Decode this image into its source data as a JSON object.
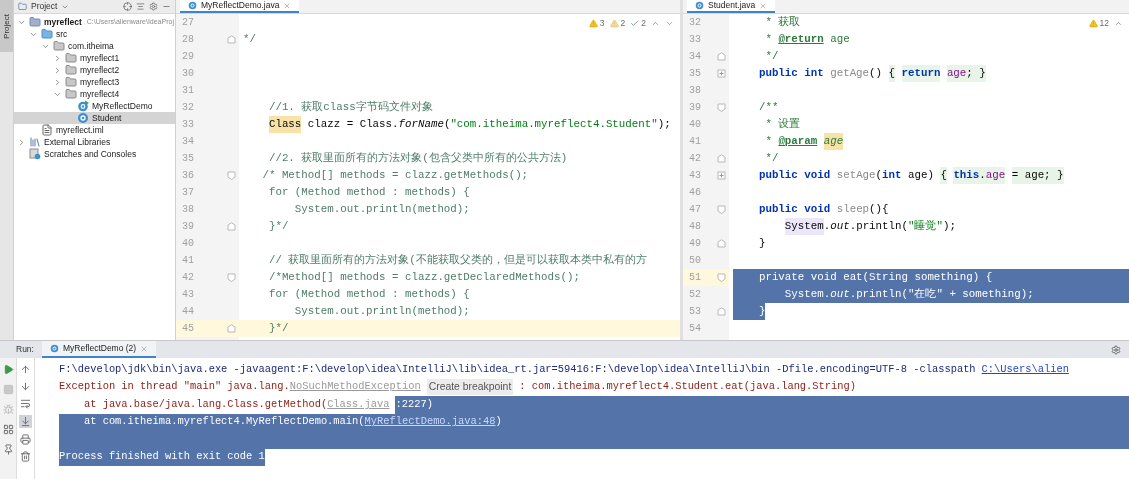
{
  "tool_strip": {
    "label": "Project",
    "selected": true
  },
  "project": {
    "title": "Project",
    "tree": [
      {
        "label": "myreflect",
        "path": "C:\\Users\\alienware\\IdeaProj",
        "kind": "module",
        "expanded": true,
        "selected": false,
        "children": [
          {
            "label": "src",
            "kind": "source",
            "expanded": true,
            "selected": false,
            "children": [
              {
                "label": "com.itheima",
                "kind": "package",
                "expanded": true,
                "selected": false,
                "children": [
                  {
                    "label": "myreflect1",
                    "kind": "package",
                    "expanded": false,
                    "selected": false
                  },
                  {
                    "label": "myreflect2",
                    "kind": "package",
                    "expanded": false,
                    "selected": false
                  },
                  {
                    "label": "myreflect3",
                    "kind": "package",
                    "expanded": false,
                    "selected": false
                  },
                  {
                    "label": "myreflect4",
                    "kind": "package",
                    "expanded": true,
                    "selected": false,
                    "children": [
                      {
                        "label": "MyReflectDemo",
                        "kind": "main-class",
                        "selected": false
                      },
                      {
                        "label": "Student",
                        "kind": "class",
                        "selected": true
                      }
                    ]
                  }
                ]
              }
            ]
          },
          {
            "label": "myreflect.iml",
            "kind": "iml",
            "selected": false
          }
        ]
      },
      {
        "label": "External Libraries",
        "kind": "libraries",
        "expanded": false,
        "selected": false
      },
      {
        "label": "Scratches and Consoles",
        "kind": "scratches",
        "selected": false
      }
    ]
  },
  "editors": [
    {
      "tab": "MyReflectDemo.java",
      "inspections": [
        {
          "kind": "warning",
          "count": "3"
        },
        {
          "kind": "weak-warning",
          "count": "2"
        },
        {
          "kind": "typo",
          "count": "2"
        }
      ],
      "lines": [
        {
          "number": "27"
        },
        {
          "number": "28",
          "fold_end": true,
          "segments": [
            {
              "text": "*/",
              "kind": "comment"
            }
          ]
        },
        {
          "number": "29"
        },
        {
          "number": "30"
        },
        {
          "number": "31"
        },
        {
          "number": "32",
          "segments": [
            {
              "text": "    //1. 获取class字节码文件对象",
              "kind": "comment"
            }
          ]
        },
        {
          "number": "33",
          "segments": [
            {
              "text": "    Class",
              "kind": "highlight"
            },
            {
              "text": " clazz = Class.",
              "kind": "plain"
            },
            {
              "text": "forName",
              "kind": "static"
            },
            {
              "text": "(",
              "kind": "plain"
            },
            {
              "text": "\"com.itheima.myreflect4.Student\"",
              "kind": "string"
            },
            {
              "text": ");",
              "kind": "plain"
            }
          ]
        },
        {
          "number": "34"
        },
        {
          "number": "35",
          "segments": [
            {
              "text": "    //2. 获取里面所有的方法对象(包含父类中所有的公共方法)",
              "kind": "comment"
            }
          ]
        },
        {
          "number": "36",
          "fold_start": true,
          "segments": [
            {
              "text": "   /* Method[] methods = clazz.getMethods();",
              "kind": "comment"
            }
          ]
        },
        {
          "number": "37",
          "segments": [
            {
              "text": "    for (Method method : methods) {",
              "kind": "comment"
            }
          ]
        },
        {
          "number": "38",
          "segments": [
            {
              "text": "        System.out.println(method);",
              "kind": "comment"
            }
          ]
        },
        {
          "number": "39",
          "fold_end": true,
          "segments": [
            {
              "text": "    }*/",
              "kind": "comment"
            }
          ]
        },
        {
          "number": "40"
        },
        {
          "number": "41",
          "segments": [
            {
              "text": "    // 获取里面所有的方法对象(不能获取父类的，但是可以获取本类中私有的方",
              "kind": "comment"
            }
          ]
        },
        {
          "number": "42",
          "fold_start": true,
          "segments": [
            {
              "text": "    /*Method[] methods = clazz.getDeclaredMethods();",
              "kind": "comment"
            }
          ]
        },
        {
          "number": "43",
          "segments": [
            {
              "text": "    for (Method method : methods) {",
              "kind": "comment"
            }
          ]
        },
        {
          "number": "44",
          "segments": [
            {
              "text": "        System.out.println(method);",
              "kind": "comment"
            }
          ]
        },
        {
          "number": "45",
          "fold_end": true,
          "current": true,
          "segments": [
            {
              "text": "    }*/",
              "kind": "comment"
            }
          ]
        }
      ]
    },
    {
      "tab": "Student.java",
      "inspections": [
        {
          "kind": "warning",
          "count": "12"
        }
      ],
      "lines": [
        {
          "number": "32",
          "segments": [
            {
              "text": "     * 获取",
              "kind": "doc"
            }
          ]
        },
        {
          "number": "33",
          "segments": [
            {
              "text": "     * ",
              "kind": "doc"
            },
            {
              "text": "@return",
              "kind": "doc-tag"
            },
            {
              "text": " age",
              "kind": "doc"
            }
          ]
        },
        {
          "number": "34",
          "fold_end": true,
          "segments": [
            {
              "text": "     */",
              "kind": "doc"
            }
          ]
        },
        {
          "number": "35",
          "collapsed": true,
          "segments": [
            {
              "text": "    public int ",
              "kind": "keyword"
            },
            {
              "text": "getAge",
              "kind": "unused"
            },
            {
              "text": "() ",
              "kind": "plain"
            },
            {
              "text": "{ ",
              "kind": "folded"
            },
            {
              "text": "return ",
              "kind": "keyword-folded"
            },
            {
              "text": "age",
              "kind": "field-folded"
            },
            {
              "text": "; }",
              "kind": "folded"
            }
          ]
        },
        {
          "number": "38"
        },
        {
          "number": "39",
          "fold_start": true,
          "segments": [
            {
              "text": "    /**",
              "kind": "doc"
            }
          ]
        },
        {
          "number": "40",
          "segments": [
            {
              "text": "     * 设置",
              "kind": "doc"
            }
          ]
        },
        {
          "number": "41",
          "segments": [
            {
              "text": "     * ",
              "kind": "doc"
            },
            {
              "text": "@param ",
              "kind": "doc-tag"
            },
            {
              "text": "age",
              "kind": "param"
            }
          ]
        },
        {
          "number": "42",
          "fold_end": true,
          "segments": [
            {
              "text": "     */",
              "kind": "doc"
            }
          ]
        },
        {
          "number": "43",
          "collapsed": true,
          "segments": [
            {
              "text": "    public void ",
              "kind": "keyword"
            },
            {
              "text": "setAge",
              "kind": "unused"
            },
            {
              "text": "(",
              "kind": "plain"
            },
            {
              "text": "int",
              "kind": "keyword"
            },
            {
              "text": " age) ",
              "kind": "plain"
            },
            {
              "text": "{ ",
              "kind": "folded"
            },
            {
              "text": "this",
              "kind": "keyword-folded"
            },
            {
              "text": ".",
              "kind": "folded"
            },
            {
              "text": "age",
              "kind": "field-folded"
            },
            {
              "text": " = age; }",
              "kind": "folded"
            }
          ]
        },
        {
          "number": "46"
        },
        {
          "number": "47",
          "fold_start": true,
          "segments": [
            {
              "text": "    public void ",
              "kind": "keyword"
            },
            {
              "text": "sleep",
              "kind": "unused"
            },
            {
              "text": "(){",
              "kind": "plain"
            }
          ]
        },
        {
          "number": "48",
          "segments": [
            {
              "text": "        System",
              "kind": "usage"
            },
            {
              "text": ".",
              "kind": "plain"
            },
            {
              "text": "out",
              "kind": "static"
            },
            {
              "text": ".println(",
              "kind": "plain"
            },
            {
              "text": "\"睡觉\"",
              "kind": "string"
            },
            {
              "text": ");",
              "kind": "plain"
            }
          ]
        },
        {
          "number": "49",
          "fold_end": true,
          "segments": [
            {
              "text": "    }",
              "kind": "plain"
            }
          ]
        },
        {
          "number": "50"
        },
        {
          "number": "51",
          "fold_start": true,
          "current": true,
          "selected": true,
          "to_end": true,
          "segments": [
            {
              "text": "    private void eat(String something) {",
              "kind": "plain"
            }
          ]
        },
        {
          "number": "52",
          "selected": true,
          "to_end": true,
          "segments": [
            {
              "text": "        System.",
              "kind": "plain"
            },
            {
              "text": "out",
              "kind": "static"
            },
            {
              "text": ".println(\"在吃\" + something);",
              "kind": "plain"
            }
          ]
        },
        {
          "number": "53",
          "fold_end": true,
          "selected": true,
          "to_end": false,
          "segments": [
            {
              "text": "    }",
              "kind": "plain"
            }
          ]
        },
        {
          "number": "54"
        }
      ]
    }
  ],
  "run": {
    "label": "Run:",
    "tab": {
      "title": "MyReflectDemo (2)",
      "selected": true
    },
    "scroll_to_end": {
      "on": true
    },
    "console": [
      {
        "fill_to_end": false,
        "segments": [
          {
            "text": "F:\\develop\\jdk\\bin\\java.exe -javaagent:F:\\develop\\idea\\IntelliJ\\lib\\idea_rt.jar=59416:F:\\develop\\idea\\IntelliJ\\bin -Dfile.encoding=UTF-8 -classpath",
            "kind": "command",
            "selected": false
          },
          {
            "text": "C:\\Users\\alien",
            "kind": "link",
            "selected": false
          }
        ]
      },
      {
        "fill_to_end": false,
        "segments": [
          {
            "text": "Exception in thread \"main\" java.lang.",
            "kind": "error",
            "selected": false
          },
          {
            "text": "NoSuchMethodException",
            "kind": "error-link",
            "selected": false
          },
          {
            "text": "Create breakpoint",
            "kind": "hint",
            "selected": false
          },
          {
            "text": ": com.itheima.myreflect4.Student.eat(java.lang.String)",
            "kind": "error",
            "selected": false
          }
        ]
      },
      {
        "fill_to_end": true,
        "segments": [
          {
            "text": "    at java.base/java.lang.Class.getMethod(",
            "kind": "error",
            "selected": false
          },
          {
            "text": "Class.java",
            "kind": "error-link",
            "selected": false
          },
          {
            "text": ":2227)",
            "kind": "error",
            "selected": true
          }
        ]
      },
      {
        "fill_to_end": true,
        "segments": [
          {
            "text": "    at com.itheima.myreflect4.MyReflectDemo.main(",
            "kind": "error",
            "selected": true
          },
          {
            "text": "MyReflectDemo.java:48",
            "kind": "link",
            "selected": true
          },
          {
            "text": ")",
            "kind": "error",
            "selected": true
          }
        ]
      },
      {
        "fill_to_end": true
      },
      {
        "fill_to_end": false,
        "segments": [
          {
            "text": "Process finished with exit code 1",
            "kind": "command",
            "selected": true
          }
        ]
      }
    ]
  }
}
